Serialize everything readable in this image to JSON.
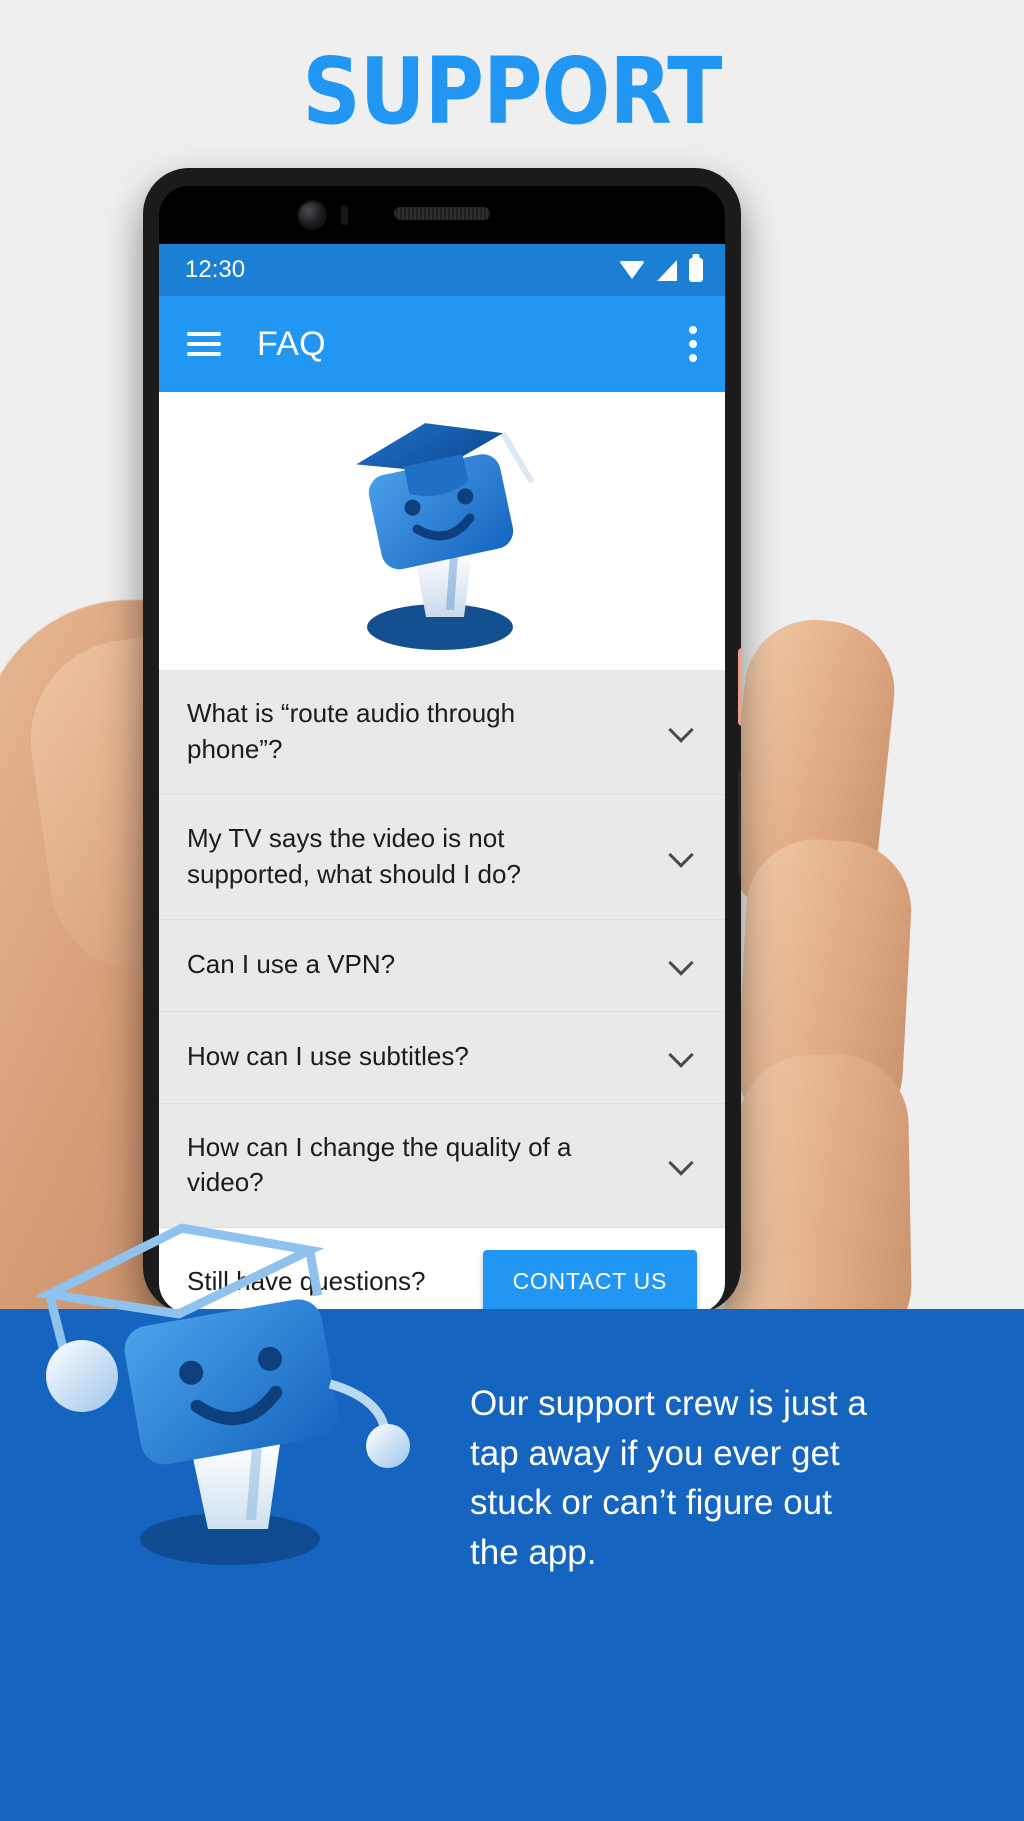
{
  "headline": "SUPPORT",
  "theme": {
    "accent": "#2196f3",
    "statusbar_blue": "#1b7fd4",
    "banner_blue": "#1565c0",
    "page_bg": "#efefef",
    "list_bg": "#e9e9e9"
  },
  "phone": {
    "statusbar": {
      "time": "12:30",
      "icons": [
        "wifi-icon",
        "cell-signal-icon",
        "battery-icon"
      ]
    },
    "appbar": {
      "menu_icon": "hamburger-menu-icon",
      "title": "FAQ",
      "overflow_icon": "kebab-menu-icon"
    },
    "hero": {
      "illustration": "graduate-mascot-illustration"
    },
    "faq": {
      "items": [
        {
          "question": "What is “route audio through phone”?",
          "expand_icon": "chevron-down-icon"
        },
        {
          "question": "My TV says the video is not supported, what should I do?",
          "expand_icon": "chevron-down-icon"
        },
        {
          "question": "Can I use a VPN?",
          "expand_icon": "chevron-down-icon"
        },
        {
          "question": "How can I use subtitles?",
          "expand_icon": "chevron-down-icon"
        },
        {
          "question": "How can I change the quality of a video?",
          "expand_icon": "chevron-down-icon"
        }
      ]
    },
    "contact": {
      "label": "Still have questions?",
      "button": "CONTACT US"
    }
  },
  "banner": {
    "text": "Our support crew is just a tap away if you ever get stuck or can’t figure out the app.",
    "mascot": "support-mascot-with-headset-illustration"
  }
}
